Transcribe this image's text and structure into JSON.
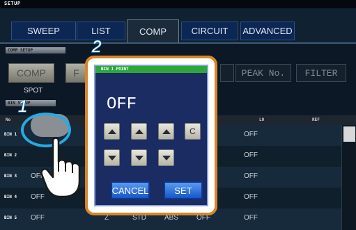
{
  "header": {
    "title": "SETUP"
  },
  "tabs": [
    {
      "label": "SWEEP"
    },
    {
      "label": "LIST"
    },
    {
      "label": "COMP",
      "active": true
    },
    {
      "label": "CIRCUIT"
    },
    {
      "label": "ADVANCED"
    }
  ],
  "comp_setup": {
    "section_label": "COMP SETUP",
    "comp_button": "COMP",
    "partial_button": "F",
    "spot_label": "SPOT",
    "peak_button": "PEAK No.",
    "filter_button": "FILTER",
    "sub_section_label": "BIN SETUP"
  },
  "table": {
    "headers": {
      "no": "No",
      "lo": "LO",
      "ref": "REF"
    },
    "rows": [
      {
        "bin": "BIN 1",
        "c1": "",
        "c2": "",
        "c3": "",
        "c4": "",
        "lo": "OFF"
      },
      {
        "bin": "BIN 2",
        "c1": "",
        "c2": "",
        "c3": "",
        "c4": "",
        "lo": "OFF"
      },
      {
        "bin": "BIN 3",
        "c1": "OFF",
        "c2": "",
        "c3": "",
        "c4": "",
        "lo": "OFF"
      },
      {
        "bin": "BIN 4",
        "c1": "OFF",
        "c2": "",
        "c3": "",
        "c4": "",
        "lo": "OFF"
      },
      {
        "bin": "BIN 5",
        "c1": "OFF",
        "c2": "Z",
        "c3": "STD",
        "c4": "ABS",
        "c5": "OFF",
        "lo": "OFF"
      }
    ]
  },
  "dialog": {
    "title": "BIN 1 POINT",
    "value": "OFF",
    "clear_key": "C",
    "cancel_button": "CANCEL",
    "set_button": "SET"
  },
  "callouts": {
    "step1": "1",
    "step2": "2"
  },
  "colors": {
    "highlight_ring": "#29a9e2",
    "dialog_frame": "#d98627",
    "dialog_title_bar": "#2ca83a",
    "dialog_button": "#1656c8"
  }
}
